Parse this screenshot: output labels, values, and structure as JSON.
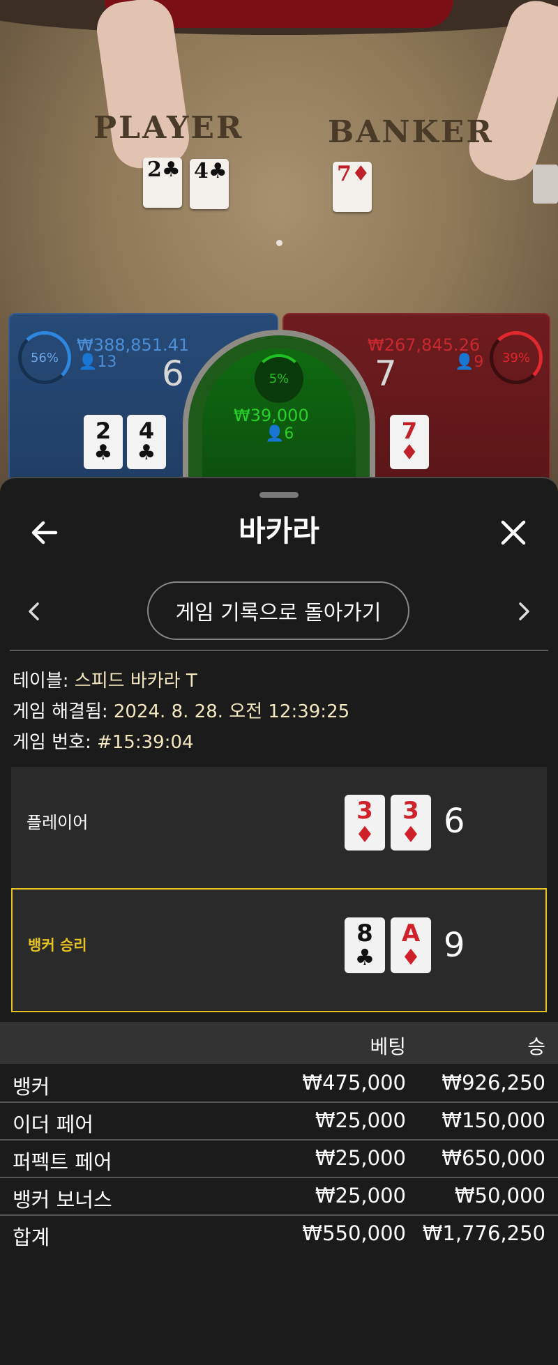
{
  "video": {
    "player_label": "PLAYER",
    "banker_label": "BANKER",
    "player_cards": [
      {
        "rank": "2",
        "suit": "♣"
      },
      {
        "rank": "4",
        "suit": "♣"
      }
    ],
    "banker_cards": [
      {
        "rank": "7",
        "suit": "♦"
      }
    ]
  },
  "player_panel": {
    "percent": "56%",
    "amount": "₩388,851.41",
    "players": "13",
    "score": "6",
    "cards": [
      {
        "rank": "2",
        "suit": "♣"
      },
      {
        "rank": "4",
        "suit": "♣"
      }
    ],
    "color": "#2e86de"
  },
  "tie_panel": {
    "percent": "5%",
    "amount": "₩39,000",
    "players": "6",
    "color": "#22c022"
  },
  "banker_panel": {
    "percent": "39%",
    "amount": "₩267,845.26",
    "players": "9",
    "score": "7",
    "cards": [
      {
        "rank": "7",
        "suit": "♦"
      }
    ],
    "color": "#e0282e"
  },
  "sheet": {
    "title": "바카라",
    "back_icon": "arrow-left-icon",
    "close_icon": "close-icon",
    "history_button": "게임 기록으로 돌아가기",
    "info": {
      "table_label": "테이블:",
      "table_value": "스피드 바카라 T",
      "resolved_label": "게임 해결됨:",
      "resolved_value": "2024. 8. 28. 오전 12:39:25",
      "number_label": "게임 번호:",
      "number_value": "#15:39:04"
    },
    "outcomes": [
      {
        "label": "플레이어",
        "cards": [
          {
            "rank": "3",
            "suit": "♦"
          },
          {
            "rank": "3",
            "suit": "♦"
          }
        ],
        "score": "6",
        "winner": false
      },
      {
        "label": "뱅커 승리",
        "cards": [
          {
            "rank": "8",
            "suit": "♣"
          },
          {
            "rank": "A",
            "suit": "♦"
          }
        ],
        "score": "9",
        "winner": true
      }
    ],
    "table": {
      "headers": {
        "bet": "베팅",
        "win": "승"
      },
      "rows": [
        {
          "name": "뱅커",
          "bet": "₩475,000",
          "win": "₩926,250"
        },
        {
          "name": "이더 페어",
          "bet": "₩25,000",
          "win": "₩150,000"
        },
        {
          "name": "퍼펙트 페어",
          "bet": "₩25,000",
          "win": "₩650,000"
        },
        {
          "name": "뱅커 보너스",
          "bet": "₩25,000",
          "win": "₩50,000"
        }
      ],
      "total": {
        "name": "합계",
        "bet": "₩550,000",
        "win": "₩1,776,250"
      }
    },
    "win_highlight_color": "#e6c21e"
  }
}
